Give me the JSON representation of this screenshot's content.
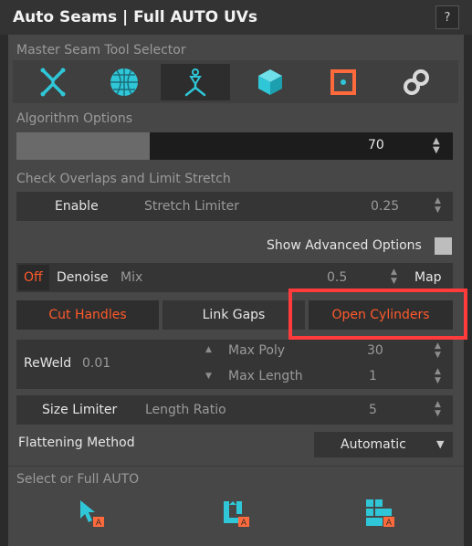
{
  "window": {
    "title": "Auto Seams | Full AUTO UVs",
    "help_label": "?"
  },
  "master": {
    "label": "Master Seam Tool Selector",
    "tools": [
      {
        "icon": "x-shape-icon"
      },
      {
        "icon": "sphere-mesh-icon"
      },
      {
        "icon": "figure-icon",
        "selected": true
      },
      {
        "icon": "cube-icon"
      },
      {
        "icon": "square-seam-icon"
      },
      {
        "icon": "link-icon"
      }
    ]
  },
  "algorithm": {
    "label": "Algorithm Options",
    "value": "70",
    "progress": 0.45
  },
  "overlaps": {
    "label": "Check Overlaps and Limit Stretch",
    "enable_label": "Enable",
    "stretch_label": "Stretch Limiter",
    "stretch_value": "0.25"
  },
  "advanced": {
    "label": "Show Advanced Options"
  },
  "denoise": {
    "off_label": "Off",
    "label": "Denoise",
    "mix_label": "Mix",
    "mix_value": "0.5",
    "map_label": "Map"
  },
  "actions": {
    "cut_handles": "Cut Handles",
    "link_gaps": "Link Gaps",
    "open_cylinders": "Open Cylinders"
  },
  "reweld": {
    "label": "ReWeld",
    "value": "0.01",
    "max_poly_label": "Max Poly",
    "max_poly_value": "30",
    "max_length_label": "Max Length",
    "max_length_value": "1"
  },
  "size": {
    "label": "Size Limiter",
    "ratio_label": "Length Ratio",
    "ratio_value": "5"
  },
  "flatten": {
    "label": "Flattening Method",
    "selected": "Automatic",
    "arrow": "▼"
  },
  "select_auto": {
    "label": "Select or Full AUTO",
    "buttons": [
      {
        "icon": "cursor-auto-icon"
      },
      {
        "icon": "uv-auto-icon"
      },
      {
        "icon": "grid-auto-icon"
      }
    ]
  },
  "colors": {
    "accent": "#ff5a2b",
    "cyan": "#2fc7d8",
    "highlight": "#ff3b3b"
  }
}
